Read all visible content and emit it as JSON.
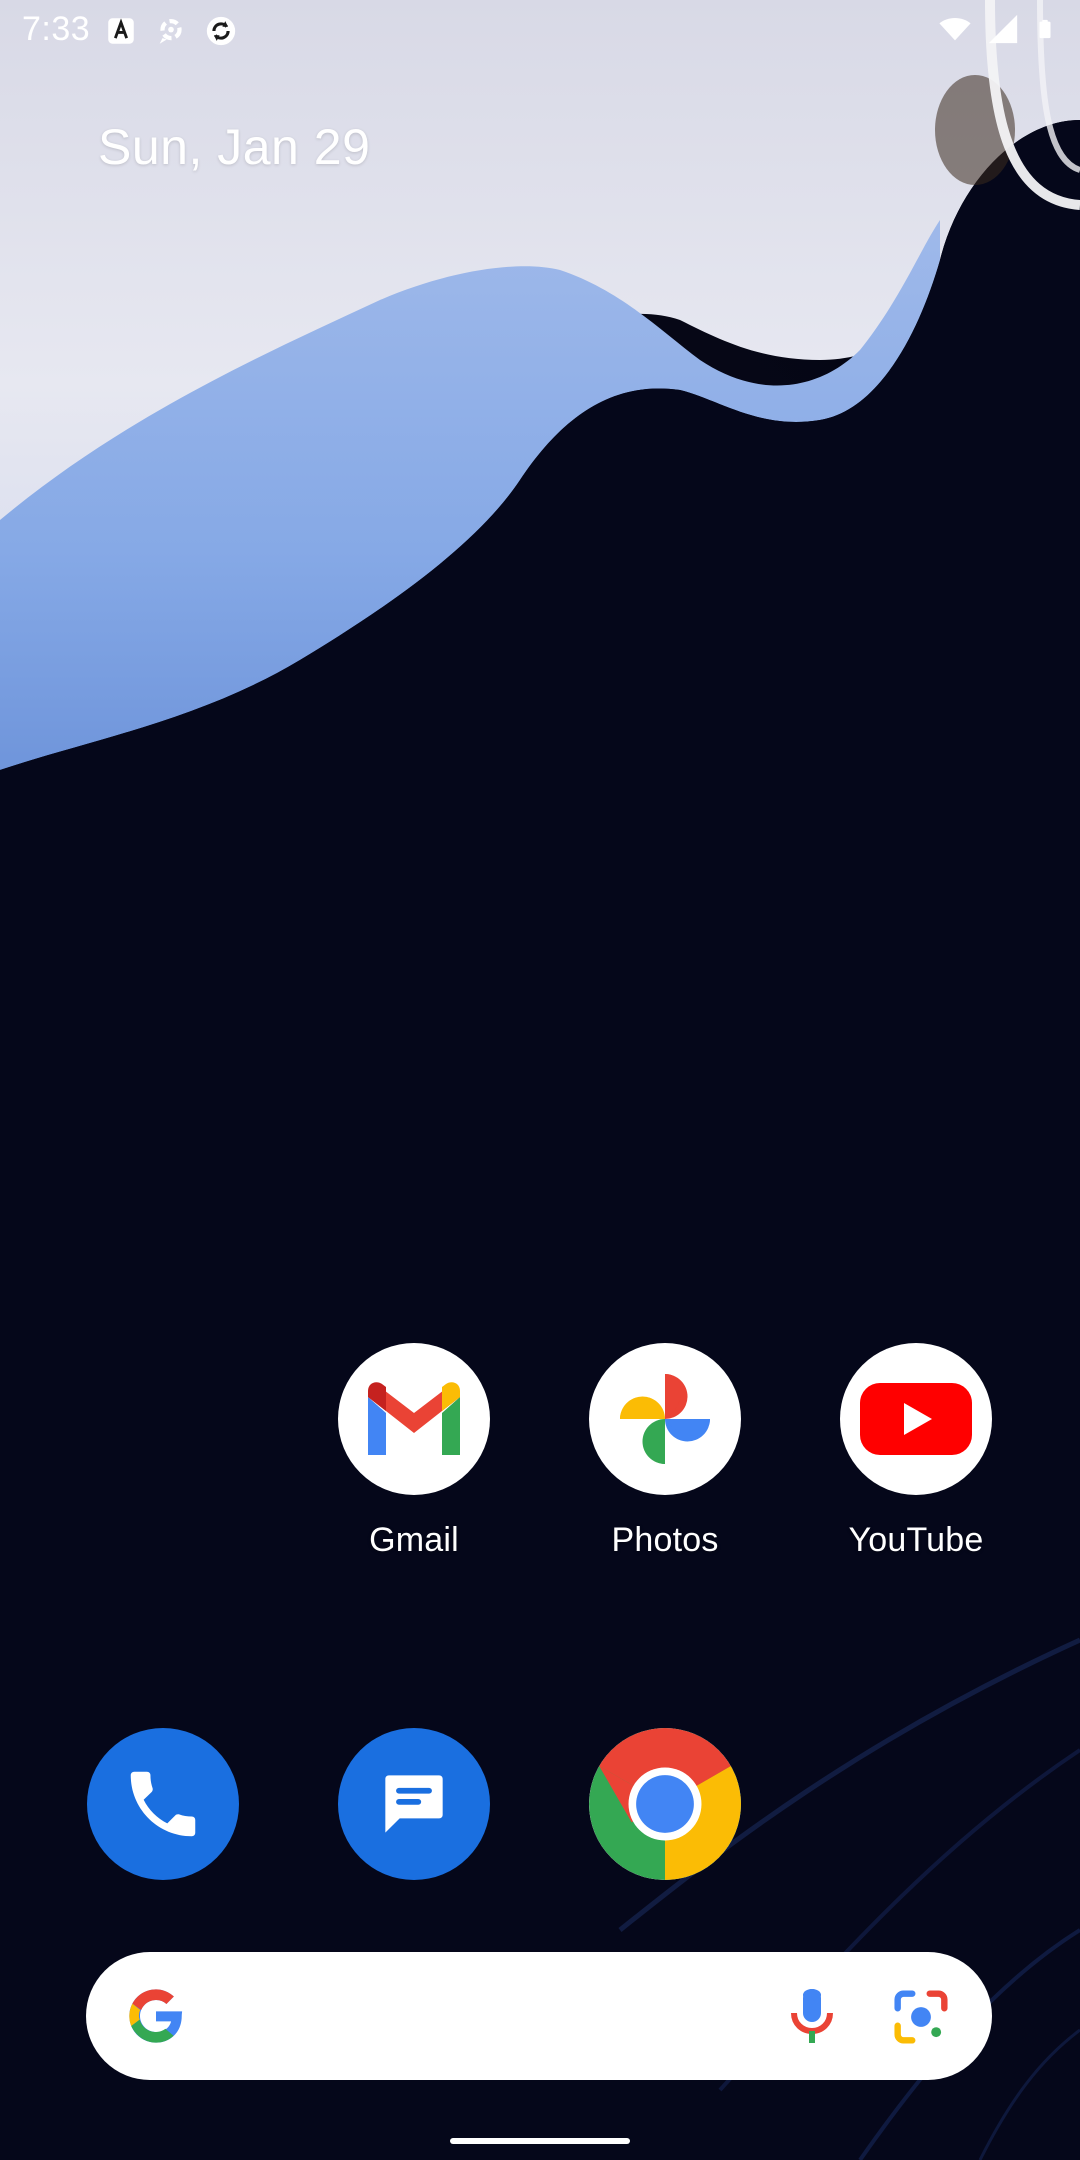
{
  "status_bar": {
    "time": "7:33",
    "left_icons": [
      "accessibility-a-icon",
      "sync-bubble-icon",
      "chrome-refresh-icon"
    ],
    "right_icons": [
      "wifi-icon",
      "signal-icon",
      "battery-icon"
    ]
  },
  "home": {
    "date": "Sun, Jan 29"
  },
  "apps_row": [
    {
      "label": "Gmail",
      "icon": "gmail-icon"
    },
    {
      "label": "Photos",
      "icon": "photos-icon"
    },
    {
      "label": "YouTube",
      "icon": "youtube-icon"
    }
  ],
  "dock": [
    {
      "label": "Phone",
      "icon": "phone-icon"
    },
    {
      "label": "Messages",
      "icon": "messages-icon"
    },
    {
      "label": "Chrome",
      "icon": "chrome-icon"
    }
  ],
  "search": {
    "placeholder": ""
  },
  "colors": {
    "wallpaper_dark": "#050717",
    "wallpaper_light": "#e6e6f1",
    "wallpaper_blue": "#8fb1e8",
    "dock_blue": "#1a6fe0",
    "google_blue": "#4285F4",
    "google_red": "#EA4335",
    "google_yellow": "#FBBC05",
    "google_green": "#34A853"
  }
}
